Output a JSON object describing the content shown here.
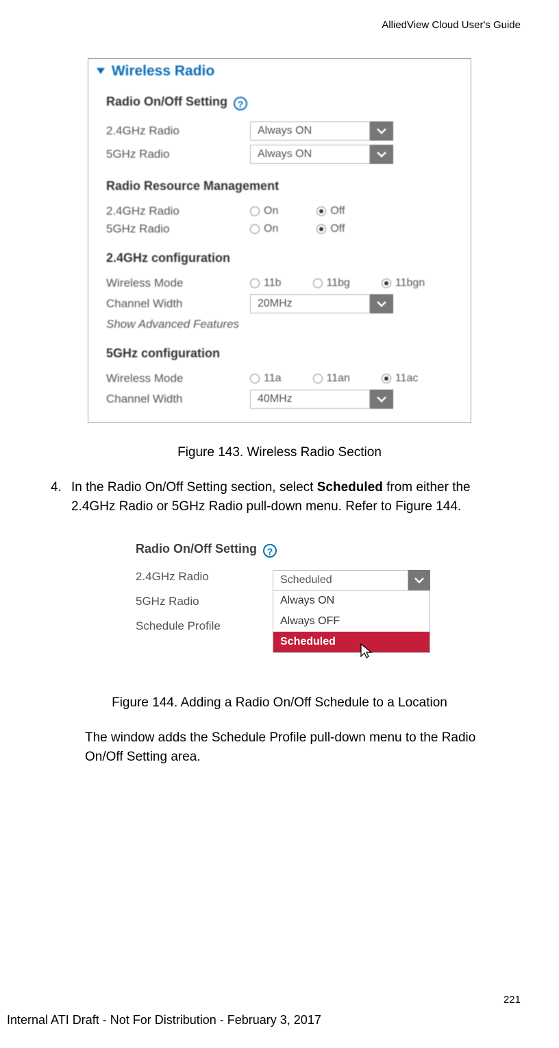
{
  "header": {
    "guide": "AlliedView Cloud User's Guide"
  },
  "fig143": {
    "title": "Wireless Radio",
    "onoff_heading": "Radio On/Off Setting",
    "r24_label": "2.4GHz Radio",
    "r24_value": "Always ON",
    "r5_label": "5GHz Radio",
    "r5_value": "Always ON",
    "rrm_heading": "Radio Resource Management",
    "rrm24_label": "2.4GHz Radio",
    "rrm5_label": "5GHz Radio",
    "on": "On",
    "off": "Off",
    "cfg24_heading": "2.4GHz configuration",
    "wm_label": "Wireless Mode",
    "modes24": {
      "a": "11b",
      "b": "11bg",
      "c": "11bgn"
    },
    "cw_label": "Channel Width",
    "cw24_value": "20MHz",
    "adv_label": "Show Advanced Features",
    "cfg5_heading": "5GHz configuration",
    "modes5": {
      "a": "11a",
      "b": "11an",
      "c": "11ac"
    },
    "cw5_value": "40MHz",
    "caption": "Figure 143. Wireless Radio Section"
  },
  "step4": {
    "num": "4.",
    "t1": "In the Radio On/Off Setting section, select ",
    "bold": "Scheduled",
    "t2": " from either the 2.4GHz Radio or 5GHz Radio pull-down menu. Refer to Figure 144."
  },
  "fig144": {
    "heading": "Radio On/Off Setting",
    "r24_label": "2.4GHz Radio",
    "r5_label": "5GHz Radio",
    "sp_label": "Schedule Profile",
    "selected": "Scheduled",
    "opt1": "Always ON",
    "opt2": "Always OFF",
    "opt3": "Scheduled",
    "caption": "Figure 144. Adding a Radio On/Off Schedule to a Location"
  },
  "para": "The window adds the Schedule Profile pull-down menu to the Radio On/Off Setting area.",
  "page": "221",
  "footer": "Internal ATI Draft - Not For Distribution - February 3, 2017"
}
